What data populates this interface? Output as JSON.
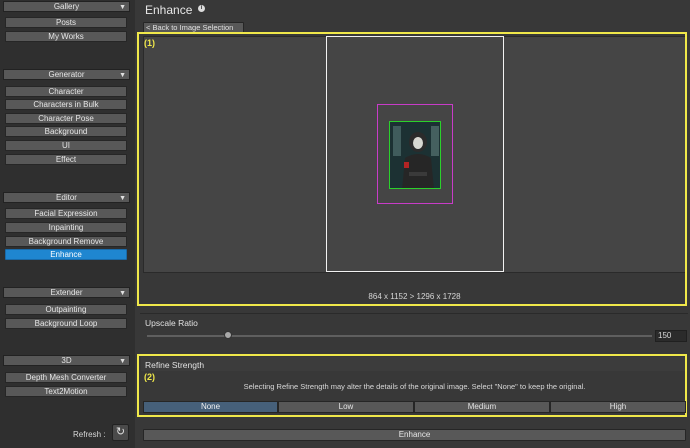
{
  "sidebar": {
    "gallery": {
      "header": "Gallery",
      "items": [
        "Posts",
        "My Works"
      ]
    },
    "generator": {
      "header": "Generator",
      "items": [
        "Character",
        "Characters in Bulk",
        "Character Pose",
        "Background",
        "UI",
        "Effect"
      ]
    },
    "editor": {
      "header": "Editor",
      "items": [
        "Facial Expression",
        "Inpainting",
        "Background Remove",
        "Enhance"
      ],
      "active": "Enhance"
    },
    "extender": {
      "header": "Extender",
      "items": [
        "Outpainting",
        "Background Loop"
      ]
    },
    "three_d": {
      "header": "3D",
      "items": [
        "Depth Mesh Converter",
        "Text2Motion"
      ]
    },
    "refresh_label": "Refresh :",
    "collapse_glyph": "▼",
    "refresh_glyph": "↻"
  },
  "main": {
    "title": "Enhance",
    "info_glyph": "i",
    "back_button": "< Back to Image Selection",
    "marker_1": "(1)",
    "marker_2": "(2)",
    "dimensions": "864 x 1152  > 1296 x 1728",
    "upscale": {
      "label": "Upscale Ratio",
      "value": "150",
      "slider_fraction": 0.16
    },
    "refine": {
      "label": "Refine Strength",
      "description": "Selecting Refine Strength may alter the details of the original image. Select \"None\" to keep the original.",
      "options": [
        "None",
        "Low",
        "Medium",
        "High"
      ],
      "selected": "None"
    },
    "enhance_button": "Enhance"
  },
  "colors": {
    "highlight_box": "#f0e84a",
    "active_nav": "#1f86d0",
    "selected_segment": "#46607a",
    "outer_frame": "#f2f2f2",
    "inner_frame": "#c83cc8",
    "thumbnail_border": "#2bd12b"
  }
}
